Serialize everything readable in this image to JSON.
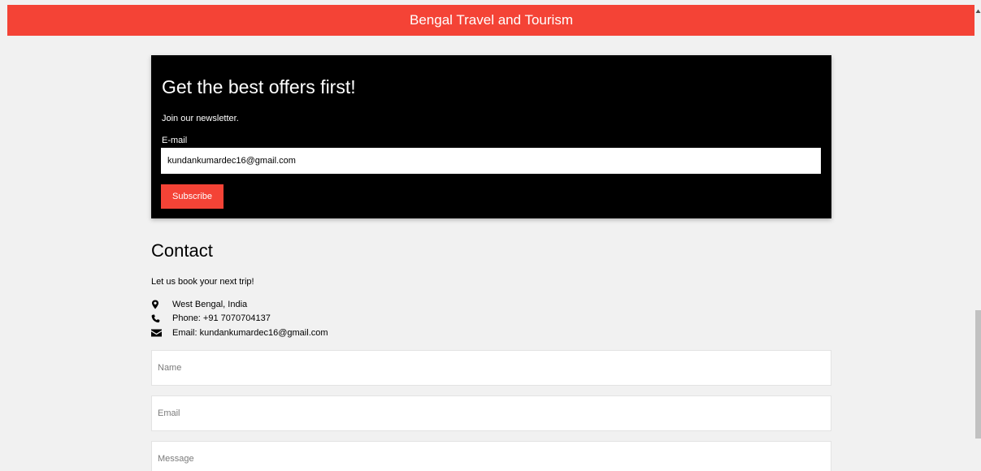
{
  "header": {
    "title": "Bengal Travel and Tourism"
  },
  "newsletter": {
    "title": "Get the best offers first!",
    "subtitle": "Join our newsletter.",
    "email_label": "E-mail",
    "email_value": "kundankumardec16@gmail.com",
    "subscribe_label": "Subscribe"
  },
  "contact": {
    "title": "Contact",
    "subtitle": "Let us book your next trip!",
    "info": [
      {
        "icon": "map-marker-icon",
        "text": "West Bengal, India"
      },
      {
        "icon": "phone-icon",
        "text": "Phone: +91 7070704137"
      },
      {
        "icon": "envelope-icon",
        "text": "Email: kundankumardec16@gmail.com"
      }
    ],
    "form": {
      "name_placeholder": "Name",
      "email_placeholder": "Email",
      "message_placeholder": "Message"
    }
  },
  "colors": {
    "accent": "#f44336",
    "background": "#f1f1f1",
    "newsletter_bg": "#000000"
  }
}
